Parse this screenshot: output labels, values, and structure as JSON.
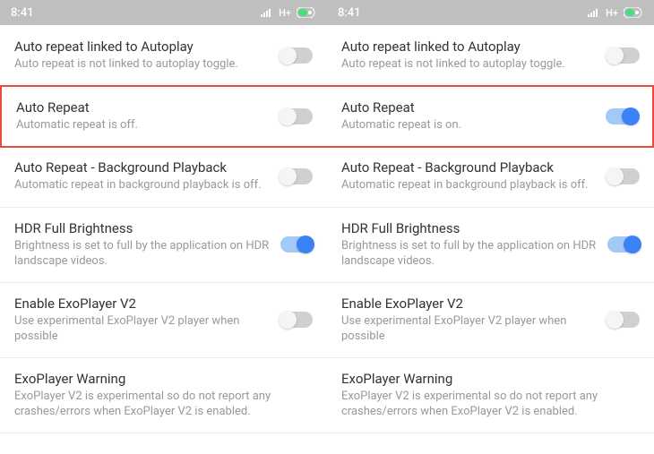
{
  "status": {
    "time": "8:41",
    "network": "H+"
  },
  "left": {
    "items": [
      {
        "title": "Auto repeat linked to Autoplay",
        "subtitle": "Auto repeat is not linked to autoplay toggle.",
        "on": false,
        "highlight": false,
        "hasToggle": true
      },
      {
        "title": "Auto Repeat",
        "subtitle": "Automatic repeat is off.",
        "on": false,
        "highlight": true,
        "hasToggle": true
      },
      {
        "title": "Auto Repeat - Background Playback",
        "subtitle": "Automatic repeat in background playback is off.",
        "on": false,
        "highlight": false,
        "hasToggle": true
      },
      {
        "title": "HDR Full Brightness",
        "subtitle": "Brightness is set to full by the application on HDR landscape videos.",
        "on": true,
        "highlight": false,
        "hasToggle": true
      },
      {
        "title": "Enable ExoPlayer V2",
        "subtitle": "Use experimental ExoPlayer V2 player when possible",
        "on": false,
        "highlight": false,
        "hasToggle": true
      },
      {
        "title": "ExoPlayer Warning",
        "subtitle": "ExoPlayer V2 is experimental so do not report any crashes/errors when ExoPlayer V2 is enabled.",
        "on": false,
        "highlight": false,
        "hasToggle": false
      }
    ]
  },
  "right": {
    "items": [
      {
        "title": "Auto repeat linked to Autoplay",
        "subtitle": "Auto repeat is not linked to autoplay toggle.",
        "on": false,
        "highlight": false,
        "hasToggle": true
      },
      {
        "title": "Auto Repeat",
        "subtitle": "Automatic repeat is on.",
        "on": true,
        "highlight": true,
        "hasToggle": true
      },
      {
        "title": "Auto Repeat - Background Playback",
        "subtitle": "Automatic repeat in background playback is off.",
        "on": false,
        "highlight": false,
        "hasToggle": true
      },
      {
        "title": "HDR Full Brightness",
        "subtitle": "Brightness is set to full by the application on HDR landscape videos.",
        "on": true,
        "highlight": false,
        "hasToggle": true
      },
      {
        "title": "Enable ExoPlayer V2",
        "subtitle": "Use experimental ExoPlayer V2 player when possible",
        "on": false,
        "highlight": false,
        "hasToggle": true
      },
      {
        "title": "ExoPlayer Warning",
        "subtitle": "ExoPlayer V2 is experimental so do not report any crashes/errors when ExoPlayer V2 is enabled.",
        "on": false,
        "highlight": false,
        "hasToggle": false
      }
    ]
  }
}
